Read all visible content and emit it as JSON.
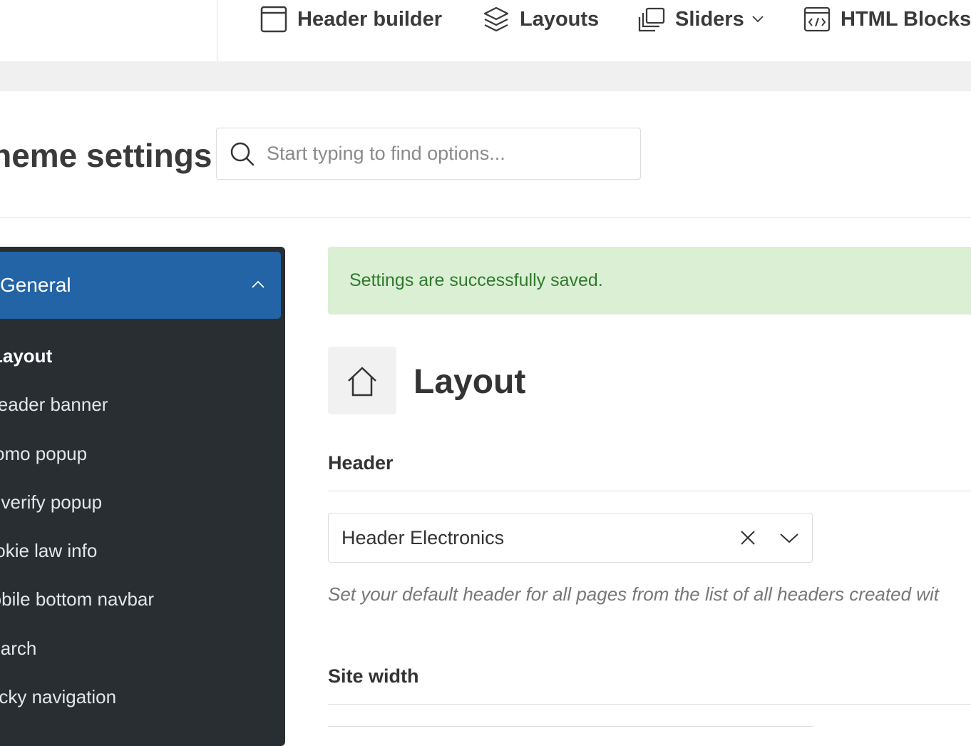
{
  "top_nav": {
    "items": [
      {
        "label": "Header builder",
        "icon": "header-builder-icon"
      },
      {
        "label": "Layouts",
        "icon": "layers-icon"
      },
      {
        "label": "Sliders",
        "icon": "sliders-icon",
        "has_dropdown": true
      },
      {
        "label": "HTML Blocks",
        "icon": "html-blocks-icon"
      }
    ]
  },
  "page": {
    "title": "Theme settings"
  },
  "search": {
    "placeholder": "Start typing to find options...",
    "value": ""
  },
  "sidebar": {
    "active_section": {
      "label": "General",
      "expanded": true
    },
    "items": [
      {
        "label": "Layout",
        "current": true
      },
      {
        "label": "Header banner"
      },
      {
        "label": "Promo popup"
      },
      {
        "label": "Age verify popup"
      },
      {
        "label": "Cookie law info"
      },
      {
        "label": "Mobile bottom navbar"
      },
      {
        "label": "Search"
      },
      {
        "label": "Sticky navigation"
      }
    ]
  },
  "alert": {
    "message": "Settings are successfully saved."
  },
  "section": {
    "title": "Layout",
    "icon": "home-icon"
  },
  "fields": {
    "header": {
      "label": "Header",
      "selected": "Header Electronics",
      "hint": "Set your default header for all pages from the list of all headers created wit"
    },
    "site_width": {
      "label": "Site width"
    }
  },
  "colors": {
    "sidebar_bg": "#292e33",
    "sidebar_active": "#2264a6",
    "alert_bg": "#dbefd4",
    "alert_text": "#2e7a2c"
  }
}
